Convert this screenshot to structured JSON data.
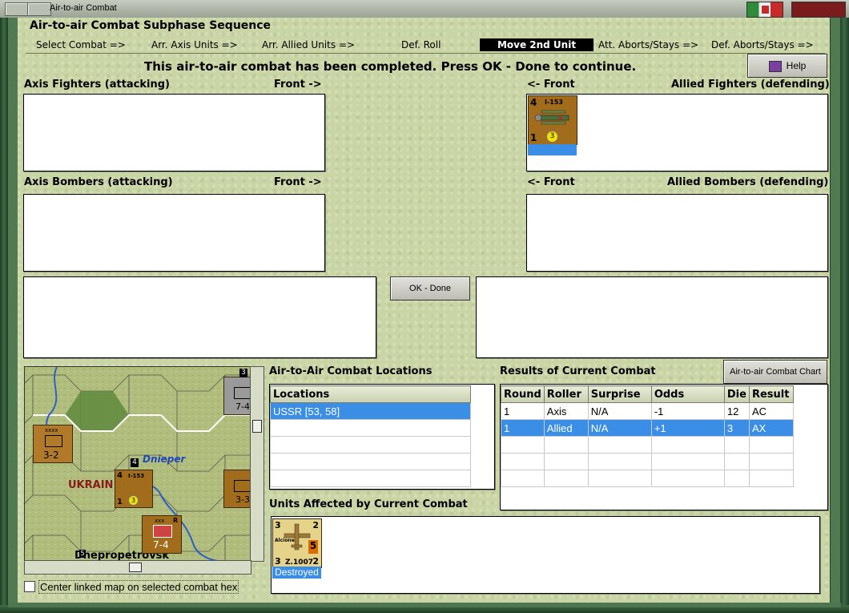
{
  "window": {
    "title": "Air-to-air Combat"
  },
  "subphase": {
    "heading": "Air-to-air Combat Subphase Sequence",
    "steps": [
      "Select Combat =>",
      "Arr. Axis Units =>",
      "Arr. Allied Units =>",
      "Def. Roll",
      "Move 2nd Unit",
      "Att. Aborts/Stays =>",
      "Def. Aborts/Stays =>"
    ],
    "active_step": "Move 2nd Unit"
  },
  "status_message": "This air-to-air combat has been completed.  Press OK - Done to continue.",
  "help_label": "Help",
  "sections": {
    "axis_fighters": "Axis Fighters (attacking)",
    "axis_fighters_front": "Front ->",
    "allied_fighters": "Allied Fighters (defending)",
    "allied_fighters_front": "<- Front",
    "axis_bombers": "Axis Bombers (attacking)",
    "axis_bombers_front": "Front ->",
    "allied_bombers": "Allied Bombers (defending)",
    "allied_bombers_front": "<- Front"
  },
  "allied_fighter_unit": {
    "name": "I-153",
    "attack": "4",
    "defense": "1",
    "range": "3"
  },
  "ok_done_label": "OK - Done",
  "locations": {
    "title": "Air-to-Air Combat Locations",
    "header": "Locations",
    "rows": [
      "USSR [53, 58]",
      "",
      "",
      "",
      "",
      ""
    ]
  },
  "results": {
    "title": "Results of Current Combat",
    "chart_button": "Air-to-air Combat Chart",
    "columns": [
      "Round",
      "Roller",
      "Surprise",
      "Odds",
      "Die",
      "Result"
    ],
    "rows": [
      [
        "1",
        "Axis",
        "N/A",
        "-1",
        "12",
        "AC"
      ],
      [
        "1",
        "Allied",
        "N/A",
        "+1",
        "3",
        "AX"
      ],
      [
        "",
        "",
        "",
        "",
        "",
        ""
      ],
      [
        "",
        "",
        "",
        "",
        "",
        ""
      ],
      [
        "",
        "",
        "",
        "",
        "",
        ""
      ],
      [
        "",
        "",
        "",
        "",
        "",
        ""
      ]
    ],
    "selected_row": 1
  },
  "affected": {
    "title": "Units Affected by Current Combat",
    "unit": {
      "name": "Z.1007",
      "label": "Alcione",
      "tl": "3",
      "tr": "2",
      "bl": "3",
      "br": "2",
      "value": "5",
      "status": "Destroyed"
    }
  },
  "map": {
    "river_label": "Dnieper",
    "region_label": "UKRAIN",
    "city_label": "Dnepropetrovsk",
    "counters": [
      {
        "top": "xxxx",
        "strength": "3-2"
      },
      {
        "name": "I-153",
        "attack": "4",
        "defense": "1",
        "range": "3",
        "stack": "4"
      },
      {
        "top": "xxx",
        "corner": "R",
        "strength": "7-4"
      },
      {
        "strength": "7-4",
        "stack": "3"
      },
      {
        "strength": "3-3"
      }
    ],
    "hex_marker": "5"
  },
  "center_map_checkbox": {
    "label": "Center linked map on selected combat hex",
    "checked": false
  },
  "colors": {
    "panel": "#c9d5a4",
    "selection": "#3a8ee6",
    "unit_brown": "#a16d1c",
    "unit_tan": "#e6d38a",
    "active_step_bg": "#000000"
  }
}
